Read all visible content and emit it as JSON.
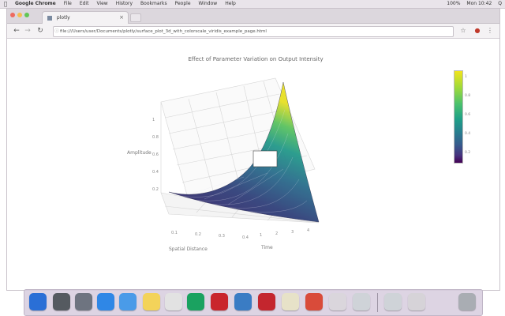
{
  "menubar": {
    "app_name": "Google Chrome",
    "items": [
      "File",
      "Edit",
      "View",
      "History",
      "Bookmarks",
      "People",
      "Window",
      "Help"
    ],
    "status_right": [
      "100%",
      "Mon 10:42",
      "Q"
    ]
  },
  "browser": {
    "tab_title": "plotly",
    "url": "file:///Users/user/Documents/plotly/surface_plot_3d_with_colorscale_viridis_example_page.html"
  },
  "plot": {
    "title": "Effect of Parameter Variation on Output Intensity",
    "axes": {
      "x_title": "Spatial Distance",
      "y_title": "Time",
      "z_title": "Amplitude"
    },
    "x_ticks": [
      "0.1",
      "0.2",
      "0.3",
      "0.4"
    ],
    "y_ticks": [
      "1",
      "2",
      "3",
      "4"
    ],
    "z_ticks": [
      "0.2",
      "0.4",
      "0.6",
      "0.8",
      "1"
    ],
    "colorbar_ticks": [
      "1",
      "0.8",
      "0.6",
      "0.4",
      "0.2"
    ],
    "colorscale": "viridis"
  },
  "dock": {
    "icons": [
      "finder-icon",
      "launchpad-icon",
      "mission-control-icon",
      "safari-icon",
      "mail-icon",
      "notes-icon",
      "calendar-icon",
      "chrome-icon",
      "acrobat-icon",
      "activity-icon",
      "pdf-icon",
      "preview-icon",
      "photos-icon",
      "window-icon",
      "window-icon-2",
      "window-icon-3",
      "window-icon-4",
      "trash-icon"
    ],
    "colors": [
      "#2a6fd6",
      "#555a60",
      "#6e7480",
      "#2f87e6",
      "#4a9be8",
      "#f3d35a",
      "#e2e2e2",
      "#1aa260",
      "#c9252c",
      "#3a7cc4",
      "#c4262e",
      "#e7e2c8",
      "#d94b3a",
      "#dad6dc",
      "#cfd3d8",
      "#cfd3d8",
      "#d6d3d8",
      "#a9adb3"
    ]
  }
}
